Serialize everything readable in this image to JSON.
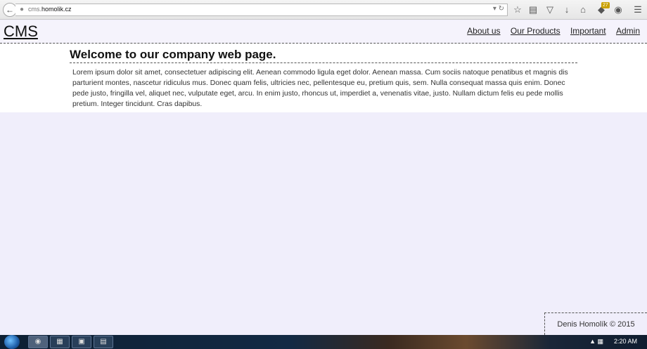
{
  "browser": {
    "url_prefix": "cms.",
    "url_domain": "homolik.cz",
    "notification_count": "27"
  },
  "site": {
    "logo": "CMS",
    "nav": [
      "About us",
      "Our Products",
      "Important",
      "Admin"
    ]
  },
  "content": {
    "title": "Welcome to our company web page.",
    "body": "Lorem ipsum dolor sit amet, consectetuer adipiscing elit. Aenean commodo ligula eget dolor. Aenean massa. Cum sociis natoque penatibus et magnis dis parturient montes, nascetur ridiculus mus. Donec quam felis, ultricies nec, pellentesque eu, pretium quis, sem. Nulla consequat massa quis enim. Donec pede justo, fringilla vel, aliquet nec, vulputate eget, arcu. In enim justo, rhoncus ut, imperdiet a, venenatis vitae, justo. Nullam dictum felis eu pede mollis pretium. Integer tincidunt. Cras dapibus."
  },
  "footer": {
    "text": "Denis Homolík © 2015"
  },
  "taskbar": {
    "clock": "2:20 AM"
  },
  "colors": {
    "page_background": "#f0eefb",
    "content_background": "#ffffff",
    "border_dashed": "#555555"
  }
}
